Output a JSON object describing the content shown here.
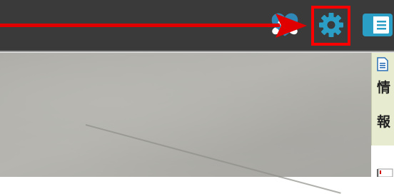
{
  "toolbar": {
    "icons": [
      {
        "name": "heart-hands-icon",
        "label": ""
      },
      {
        "name": "gear-icon",
        "label": ""
      },
      {
        "name": "panel-icon",
        "label": ""
      }
    ],
    "highlight_color": "#ff0000",
    "gear_color": "#2b9ec5"
  },
  "side_panel": {
    "doc_icon": "document-icon",
    "chars": [
      "情",
      "報"
    ],
    "background": "#e7ebcf"
  },
  "annotation": {
    "arrow_color": "#e00000",
    "target": "gear-icon"
  }
}
